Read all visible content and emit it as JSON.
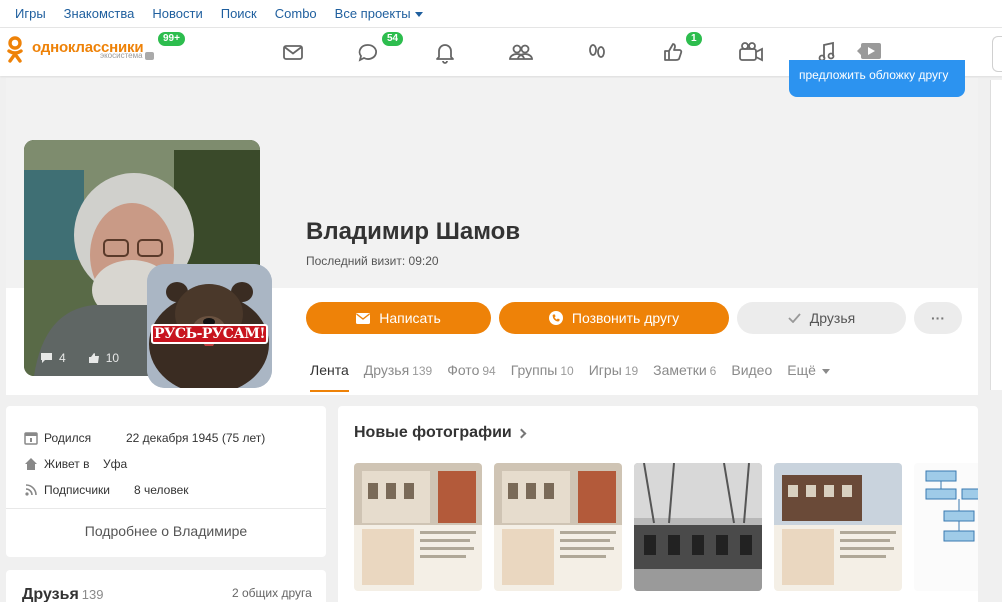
{
  "toplinks": {
    "items": [
      "Игры",
      "Знакомства",
      "Новости",
      "Поиск",
      "Combo",
      "Все проекты"
    ]
  },
  "header": {
    "logo_text": "одноклассники",
    "logo_sub": "экосистема",
    "logo_badge": "99+",
    "messages_badge": "54",
    "likes_badge": "1",
    "icons": [
      "mail-icon",
      "discussions-icon",
      "notifications-icon",
      "friends-icon",
      "guests-icon",
      "likes-icon",
      "video-icon",
      "music-icon",
      "stream-icon"
    ]
  },
  "cover": {
    "tip": "предложить обложку другу"
  },
  "avatar": {
    "comments": "4",
    "likes": "10",
    "sticker_text": "РУСЬ-РУСАМ!"
  },
  "profile": {
    "name": "Владимир Шамов",
    "last_visit": "Последний визит: 09:20"
  },
  "actions": {
    "write": "Написать",
    "call": "Позвонить другу",
    "friends": "Друзья",
    "more": "···"
  },
  "tabs": [
    {
      "label": "Лента",
      "count": ""
    },
    {
      "label": "Друзья",
      "count": "139"
    },
    {
      "label": "Фото",
      "count": "94"
    },
    {
      "label": "Группы",
      "count": "10"
    },
    {
      "label": "Игры",
      "count": "19"
    },
    {
      "label": "Заметки",
      "count": "6"
    },
    {
      "label": "Видео",
      "count": ""
    },
    {
      "label": "Ещё",
      "count": ""
    }
  ],
  "info": {
    "born_label": "Родился",
    "born_value": "22 декабря 1945 (75 лет)",
    "lives_label": "Живет в",
    "lives_value": "Уфа",
    "subs_label": "Подписчики",
    "subs_value": "8 человек",
    "more": "Подробнее о Владимире"
  },
  "friends": {
    "title": "Друзья",
    "count": "139",
    "common": "2 общих друга"
  },
  "photos": {
    "title": "Новые фотографии"
  },
  "colors": {
    "brand": "#ee8208",
    "link": "#1f5f9e",
    "badge": "#2dbd4e",
    "tip": "#2c93f0"
  }
}
